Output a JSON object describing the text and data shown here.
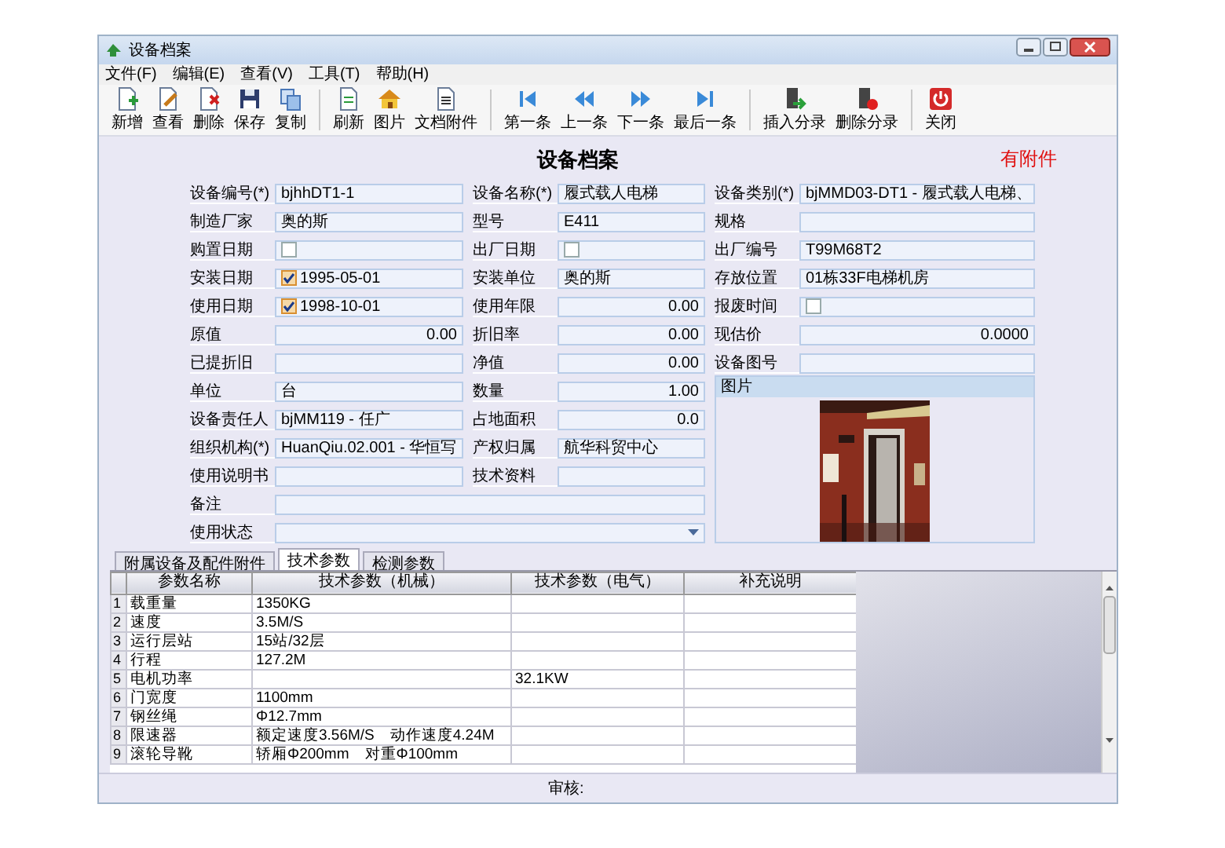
{
  "window": {
    "title": "设备档案"
  },
  "menu": [
    "文件(F)",
    "编辑(E)",
    "查看(V)",
    "工具(T)",
    "帮助(H)"
  ],
  "toolbar": {
    "groups": [
      [
        {
          "label": "新增"
        },
        {
          "label": "查看"
        },
        {
          "label": "删除"
        },
        {
          "label": "保存"
        },
        {
          "label": "复制"
        }
      ],
      [
        {
          "label": "刷新"
        },
        {
          "label": "图片"
        },
        {
          "label": "文档附件"
        }
      ],
      [
        {
          "label": "第一条"
        },
        {
          "label": "上一条"
        },
        {
          "label": "下一条"
        },
        {
          "label": "最后一条"
        }
      ],
      [
        {
          "label": "插入分录"
        },
        {
          "label": "删除分录"
        }
      ],
      [
        {
          "label": "关闭"
        }
      ]
    ]
  },
  "form": {
    "heading": "设备档案",
    "attachment_note": "有附件",
    "rows": [
      [
        {
          "label": "设备编号(*)",
          "kind": "text",
          "value": "bjhhDT1-1"
        },
        {
          "label": "设备名称(*)",
          "kind": "text",
          "value": "履式载人电梯"
        },
        {
          "label": "设备类别(*)",
          "kind": "text",
          "value": "bjMMD03-DT1 - 履式载人电梯、"
        }
      ],
      [
        {
          "label": "制造厂家",
          "kind": "text",
          "value": "奥的斯"
        },
        {
          "label": "型号",
          "kind": "text",
          "value": "E411"
        },
        {
          "label": "规格",
          "kind": "text"
        }
      ],
      [
        {
          "label": "购置日期",
          "kind": "date",
          "checked": false
        },
        {
          "label": "出厂日期",
          "kind": "date",
          "checked": false
        },
        {
          "label": "出厂编号",
          "kind": "text",
          "value": "T99M68T2"
        }
      ],
      [
        {
          "label": "安装日期",
          "kind": "date",
          "checked": true,
          "value": "1995-05-01"
        },
        {
          "label": "安装单位",
          "kind": "text",
          "value": "奥的斯"
        },
        {
          "label": "存放位置",
          "kind": "text",
          "value": "01栋33F电梯机房"
        }
      ],
      [
        {
          "label": "使用日期",
          "kind": "date",
          "checked": true,
          "value": "1998-10-01"
        },
        {
          "label": "使用年限",
          "kind": "number",
          "value": "0.00"
        },
        {
          "label": "报废时间",
          "kind": "date",
          "checked": false
        }
      ],
      [
        {
          "label": "原值",
          "kind": "number",
          "value": "0.00"
        },
        {
          "label": "折旧率",
          "kind": "number",
          "value": "0.00"
        },
        {
          "label": "现估价",
          "kind": "number",
          "value": "0.0000"
        }
      ],
      [
        {
          "label": "已提折旧",
          "kind": "text"
        },
        {
          "label": "净值",
          "kind": "number",
          "value": "0.00"
        },
        {
          "label": "设备图号",
          "kind": "text"
        }
      ],
      [
        {
          "label": "单位",
          "kind": "text",
          "value": "台"
        },
        {
          "label": "数量",
          "kind": "number",
          "value": "1.00"
        }
      ],
      [
        {
          "label": "设备责任人",
          "kind": "text",
          "value": "bjMM119 - 任广"
        },
        {
          "label": "占地面积",
          "kind": "number",
          "value": "0.0"
        }
      ],
      [
        {
          "label": "组织机构(*)",
          "kind": "text",
          "value": "HuanQiu.02.001 - 华恒写"
        },
        {
          "label": "产权归属",
          "kind": "text",
          "value": "航华科贸中心"
        }
      ],
      [
        {
          "label": "使用说明书",
          "kind": "text"
        },
        {
          "label": "技术资料",
          "kind": "text"
        }
      ],
      [
        {
          "label": "备注",
          "kind": "text"
        }
      ],
      [
        {
          "label": "使用状态",
          "kind": "select"
        }
      ]
    ],
    "picture_panel": {
      "title": "图片"
    }
  },
  "tabs": [
    {
      "label": "附属设备及配件附件",
      "selected": false
    },
    {
      "label": "技术参数",
      "selected": true
    },
    {
      "label": "检测参数",
      "selected": false
    }
  ],
  "table": {
    "columns": [
      "参数名称",
      "技术参数（机械）",
      "技术参数（电气）",
      "补充说明"
    ],
    "rows": [
      {
        "number": "1",
        "name": "载重量",
        "mechanical": "1350KG"
      },
      {
        "number": "2",
        "name": "速度",
        "mechanical": "3.5M/S"
      },
      {
        "number": "3",
        "name": "运行层站",
        "mechanical": "15站/32层"
      },
      {
        "number": "4",
        "name": "行程",
        "mechanical": "127.2M"
      },
      {
        "number": "5",
        "name": "电机功率",
        "electrical": "32.1KW"
      },
      {
        "number": "6",
        "name": "门宽度",
        "mechanical": "1100mm"
      },
      {
        "number": "7",
        "name": "钢丝绳",
        "mechanical": "Φ12.7mm"
      },
      {
        "number": "8",
        "name": "限速器",
        "mechanical": "额定速度3.56M/S　动作速度4.24M"
      },
      {
        "number": "9",
        "name": "滚轮导靴",
        "mechanical": "轿厢Φ200mm　对重Φ100mm"
      }
    ]
  },
  "footer": {
    "label": "审核:"
  }
}
